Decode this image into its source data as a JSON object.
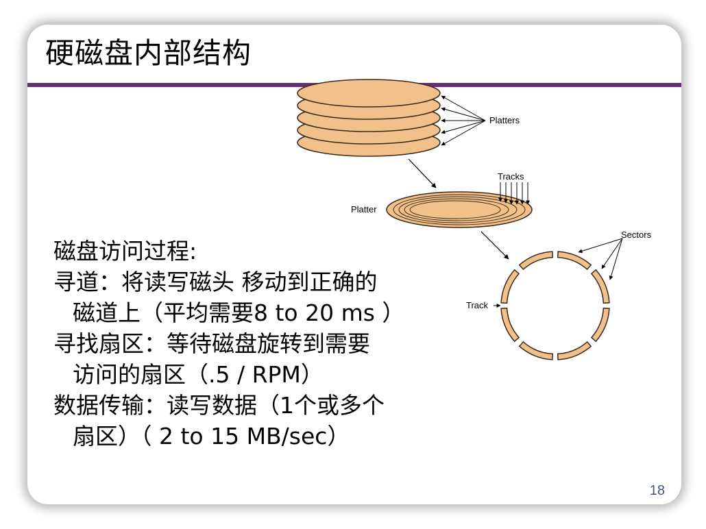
{
  "slide": {
    "title": "硬磁盘内部结构",
    "page_number": "18"
  },
  "body": {
    "lines": [
      "磁盘访问过程:",
      "寻道：将读写磁头 移动到正确的",
      "磁道上（平均需要8 to 20 ms ）",
      "寻找扇区：等待磁盘旋转到需要",
      "访问的扇区（.5 / RPM）",
      "数据传输：读写数据（1个或多个",
      "扇区）（ 2 to 15 MB/sec）"
    ]
  },
  "diagram": {
    "labels": {
      "platters": "Platters",
      "tracks": "Tracks",
      "platter": "Platter",
      "sectors": "Sectors",
      "track": "Track"
    },
    "colors": {
      "platter_fill": "#f2c08a",
      "outline": "#3a2a1a",
      "accent_rule": "#6b2a7a"
    }
  }
}
